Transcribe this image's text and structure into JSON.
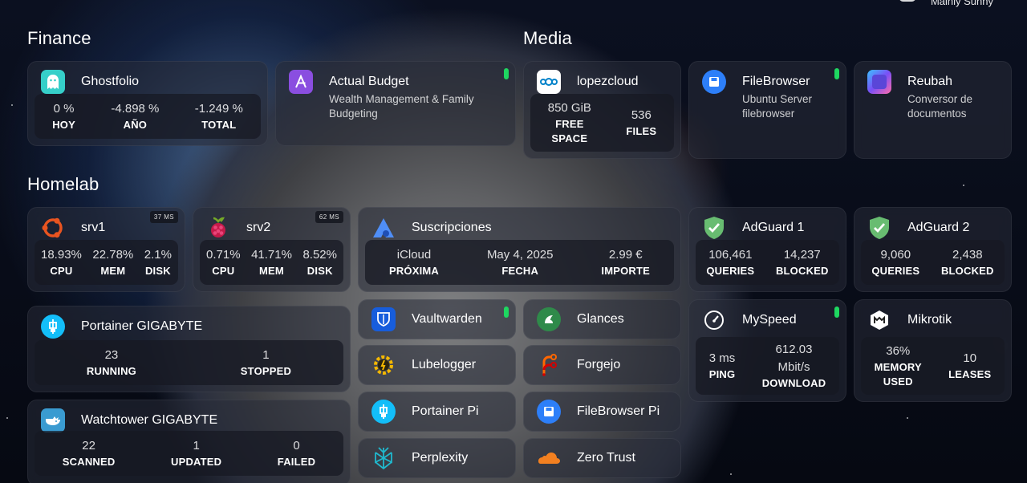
{
  "weather": {
    "text": "Mainly Sunny"
  },
  "sections": {
    "finance": "Finance",
    "media": "Media",
    "homelab": "Homelab"
  },
  "ghostfolio": {
    "title": "Ghostfolio",
    "stats": [
      {
        "value": "0 %",
        "label": "HOY"
      },
      {
        "value": "-4.898 %",
        "label": "AÑO"
      },
      {
        "value": "-1.249 %",
        "label": "TOTAL"
      }
    ]
  },
  "actual": {
    "title": "Actual Budget",
    "desc1": "Wealth Management & Family",
    "desc2": "Budgeting"
  },
  "lopezcloud": {
    "title": "lopezcloud",
    "stats": [
      {
        "value": "850 GiB",
        "label1": "FREE",
        "label2": "SPACE"
      },
      {
        "value": "536",
        "label1": "FILES"
      }
    ]
  },
  "filebrowser": {
    "title": "FileBrowser",
    "desc1": "Ubuntu Server",
    "desc2": "filebrowser"
  },
  "reubah": {
    "title": "Reubah",
    "desc1": "Conversor de",
    "desc2": "documentos"
  },
  "srv1": {
    "title": "srv1",
    "badge": "37 MS",
    "stats": [
      {
        "value": "18.93%",
        "label": "CPU"
      },
      {
        "value": "22.78%",
        "label": "MEM"
      },
      {
        "value": "2.1%",
        "label": "DISK"
      }
    ]
  },
  "srv2": {
    "title": "srv2",
    "badge": "62 MS",
    "stats": [
      {
        "value": "0.71%",
        "label": "CPU"
      },
      {
        "value": "41.71%",
        "label": "MEM"
      },
      {
        "value": "8.52%",
        "label": "DISK"
      }
    ]
  },
  "suscripciones": {
    "title": "Suscripciones",
    "stats": [
      {
        "value": "iCloud",
        "label": "PRÓXIMA"
      },
      {
        "value": "May 4, 2025",
        "label": "FECHA"
      },
      {
        "value": "2.99 €",
        "label": "IMPORTE"
      }
    ]
  },
  "adguard1": {
    "title": "AdGuard 1",
    "stats": [
      {
        "value": "106,461",
        "label": "QUERIES"
      },
      {
        "value": "14,237",
        "label": "BLOCKED"
      }
    ]
  },
  "adguard2": {
    "title": "AdGuard 2",
    "stats": [
      {
        "value": "9,060",
        "label": "QUERIES"
      },
      {
        "value": "2,438",
        "label": "BLOCKED"
      }
    ]
  },
  "portainer": {
    "title": "Portainer GIGABYTE",
    "stats": [
      {
        "value": "23",
        "label": "RUNNING"
      },
      {
        "value": "1",
        "label": "STOPPED"
      }
    ]
  },
  "watchtower": {
    "title": "Watchtower GIGABYTE",
    "stats": [
      {
        "value": "22",
        "label": "SCANNED"
      },
      {
        "value": "1",
        "label": "UPDATED"
      },
      {
        "value": "0",
        "label": "FAILED"
      }
    ]
  },
  "apps": {
    "vaultwarden": "Vaultwarden",
    "glances": "Glances",
    "lubelogger": "Lubelogger",
    "forgejo": "Forgejo",
    "portainer_pi": "Portainer Pi",
    "filebrowser_pi": "FileBrowser Pi",
    "perplexity": "Perplexity",
    "zero_trust": "Zero Trust"
  },
  "myspeed": {
    "title": "MySpeed",
    "ping_value": "3 ms",
    "ping_label": "PING",
    "download_value1": "612.03",
    "download_value2": "Mbit/s",
    "download_label": "DOWNLOAD"
  },
  "mikrotik": {
    "title": "Mikrotik",
    "memory_value": "36%",
    "memory_label1": "MEMORY",
    "memory_label2": "USED",
    "leases_value": "10",
    "leases_label": "LEASES"
  },
  "colors": {
    "status_ok": "#1ed760",
    "accent_blue": "#2d7ff9"
  }
}
